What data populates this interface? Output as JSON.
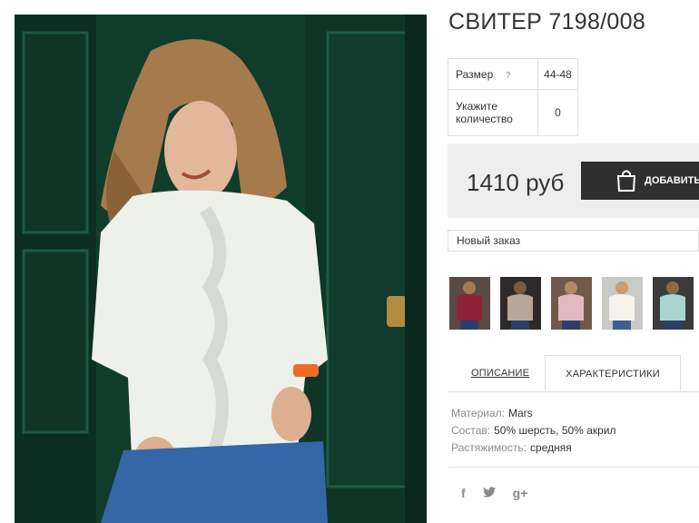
{
  "product": {
    "title": "СВИТЕР 7198/008"
  },
  "params": {
    "size_label": "Размер",
    "size_help": "?",
    "size_value": "44-48",
    "qty_label": "Укажите количество",
    "qty_value": "0"
  },
  "purchase": {
    "price": "1410 руб",
    "add_button": "ДОБАВИТЬ",
    "order_select": "Новый заказ"
  },
  "thumbnails": [
    {
      "name": "burgundy-sweater",
      "color": "#8d2236"
    },
    {
      "name": "beige-sweater",
      "color": "#b7a79b"
    },
    {
      "name": "pink-sweater",
      "color": "#e2b9c1"
    },
    {
      "name": "white-sweater",
      "color": "#f0ede4"
    },
    {
      "name": "mint-sweater",
      "color": "#a8d6cf"
    }
  ],
  "tabs": {
    "description": "ОПИСАНИЕ",
    "characteristics": "ХАРАКТЕРИСТИКИ"
  },
  "characteristics": {
    "material_label": "Материал:",
    "material_value": "Mars",
    "composition_label": "Состав:",
    "composition_value": "50% шерсть, 50% акрил",
    "stretch_label": "Растяжимость:",
    "stretch_value": "средняя"
  },
  "social": {
    "facebook": "f",
    "twitter_icon": "twitter-icon",
    "googleplus": "g+"
  }
}
